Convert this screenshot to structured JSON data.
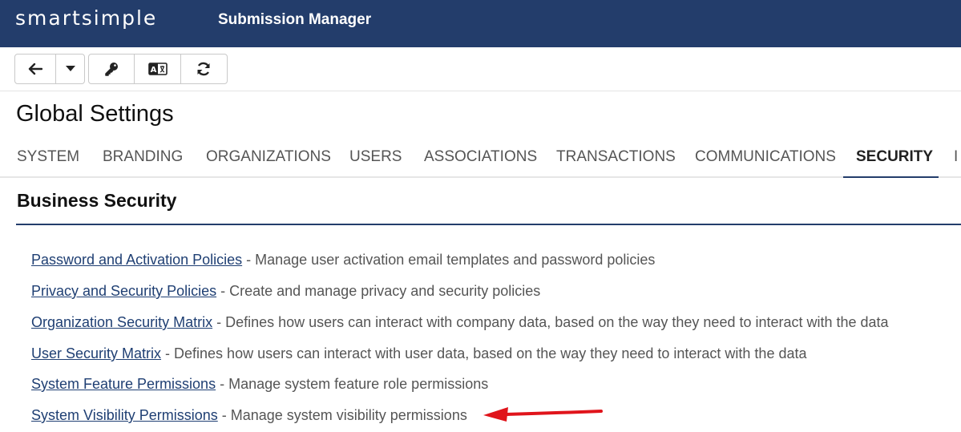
{
  "header": {
    "logo": "smartsimple",
    "app_title": "Submission Manager",
    "background": "#233d6b"
  },
  "toolbar": {
    "buttons": [
      {
        "icon": "arrow-left-icon"
      },
      {
        "icon": "caret-down-icon"
      },
      {
        "icon": "key-icon"
      },
      {
        "icon": "translate-icon"
      },
      {
        "icon": "refresh-icon"
      }
    ]
  },
  "page": {
    "title": "Global Settings"
  },
  "tabs": [
    {
      "label": "SYSTEM",
      "active": false
    },
    {
      "label": "BRANDING",
      "active": false
    },
    {
      "label": "ORGANIZATIONS",
      "active": false
    },
    {
      "label": "USERS",
      "active": false
    },
    {
      "label": "ASSOCIATIONS",
      "active": false
    },
    {
      "label": "TRANSACTIONS",
      "active": false
    },
    {
      "label": "COMMUNICATIONS",
      "active": false
    },
    {
      "label": "SECURITY",
      "active": true
    },
    {
      "label": "I",
      "active": false
    }
  ],
  "section": {
    "title": "Business Security",
    "links": [
      {
        "label": "Password and Activation Policies",
        "description": " - Manage user activation email templates and password policies"
      },
      {
        "label": "Privacy and Security Policies",
        "description": " - Create and manage privacy and security policies"
      },
      {
        "label": "Organization Security Matrix",
        "description": " - Defines how users can interact with company data, based on the way they need to interact with the data"
      },
      {
        "label": "User Security Matrix",
        "description": " - Defines how users can interact with user data, based on the way they need to interact with the data"
      },
      {
        "label": "System Feature Permissions",
        "description": " - Manage system feature role permissions"
      },
      {
        "label": "System Visibility Permissions",
        "description": " - Manage system visibility permissions"
      }
    ]
  },
  "annotation": {
    "icon": "red-arrow-icon",
    "color": "#e0141b"
  }
}
